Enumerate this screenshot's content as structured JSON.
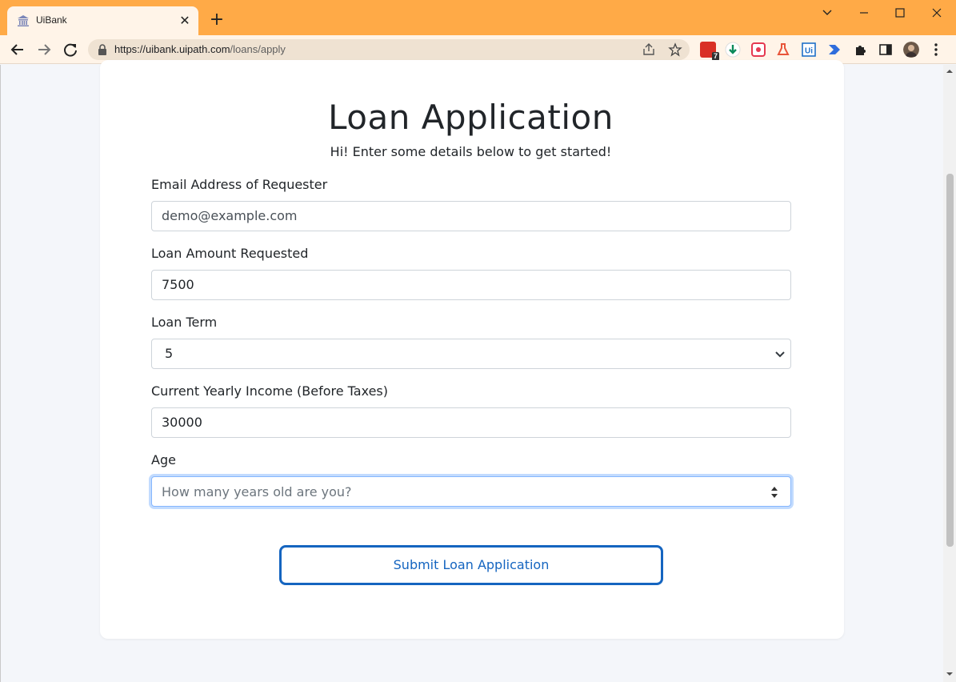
{
  "browser": {
    "tab_title": "UiBank",
    "tab_close": "✕",
    "new_tab": "+",
    "url_host": "https://uibank.uipath.com",
    "url_path": "/loans/apply",
    "badge_count": "7"
  },
  "page": {
    "title": "Loan Application",
    "subtitle": "Hi! Enter some details below to get started!",
    "email": {
      "label": "Email Address of Requester",
      "value": "demo@example.com"
    },
    "amount": {
      "label": "Loan Amount Requested",
      "value": "7500"
    },
    "term": {
      "label": "Loan Term",
      "value": "5"
    },
    "income": {
      "label": "Current Yearly Income (Before Taxes)",
      "value": "30000"
    },
    "age": {
      "label": "Age",
      "value": "",
      "placeholder": "How many years old are you?"
    },
    "submit_label": "Submit Loan Application"
  },
  "colors": {
    "browser_frame": "#ffaa47",
    "accent_blue": "#1565c0",
    "focus_ring": "#86b7fe"
  }
}
